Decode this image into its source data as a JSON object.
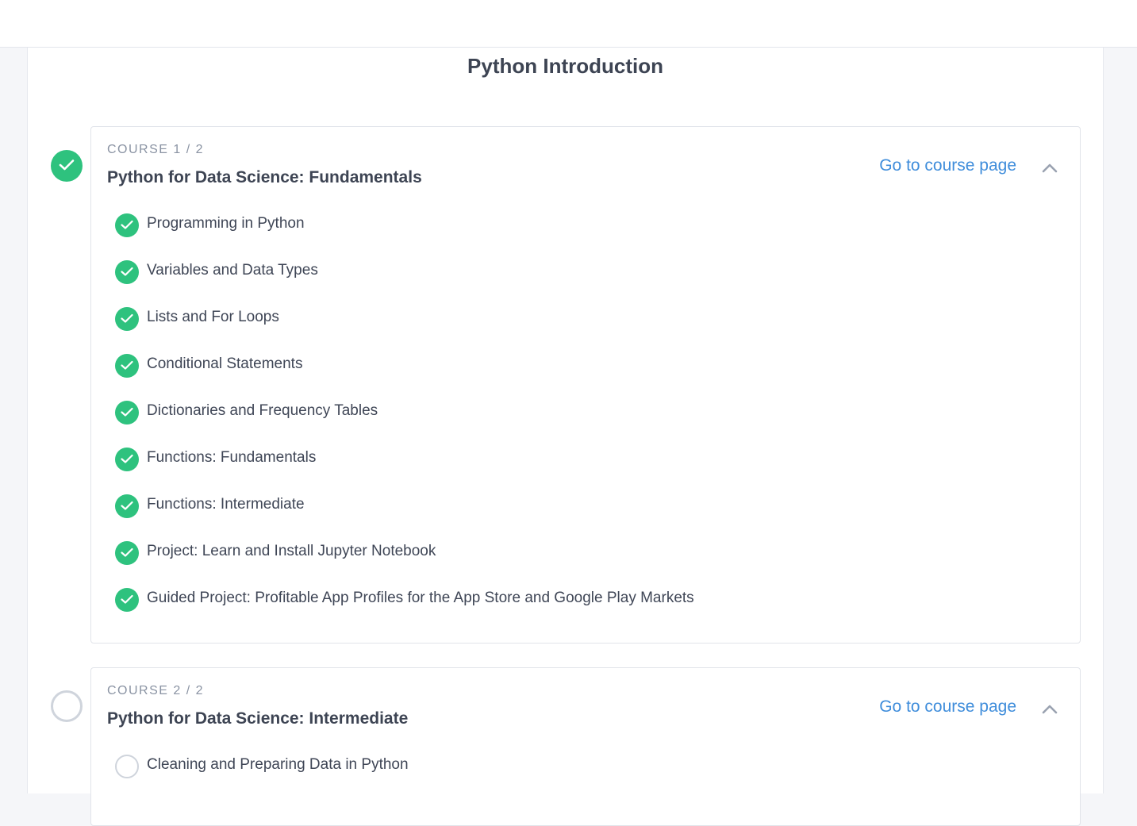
{
  "page": {
    "title": "Python Introduction"
  },
  "courses": [
    {
      "label": "COURSE 1 / 2",
      "name": "Python for Data Science: Fundamentals",
      "link_label": "Go to course page",
      "status": "completed",
      "lessons": [
        {
          "title": "Programming in Python",
          "status": "completed"
        },
        {
          "title": "Variables and Data Types",
          "status": "completed"
        },
        {
          "title": "Lists and For Loops",
          "status": "completed"
        },
        {
          "title": "Conditional Statements",
          "status": "completed"
        },
        {
          "title": "Dictionaries and Frequency Tables",
          "status": "completed"
        },
        {
          "title": "Functions: Fundamentals",
          "status": "completed"
        },
        {
          "title": "Functions: Intermediate",
          "status": "completed"
        },
        {
          "title": "Project: Learn and Install Jupyter Notebook",
          "status": "completed"
        },
        {
          "title": "Guided Project: Profitable App Profiles for the App Store and Google Play Markets",
          "status": "completed"
        }
      ]
    },
    {
      "label": "COURSE 2 / 2",
      "name": "Python for Data Science: Intermediate",
      "link_label": "Go to course page",
      "status": "not-started",
      "lessons": [
        {
          "title": "Cleaning and Preparing Data in Python",
          "status": "not-started"
        }
      ]
    }
  ],
  "icons": {
    "completed": "check-icon",
    "not_started": "empty-circle-icon",
    "collapse": "chevron-up-icon"
  },
  "colors": {
    "success": "#2ec27e",
    "link": "#3f8ddb",
    "muted": "#8a93a3",
    "text": "#3d4453"
  }
}
